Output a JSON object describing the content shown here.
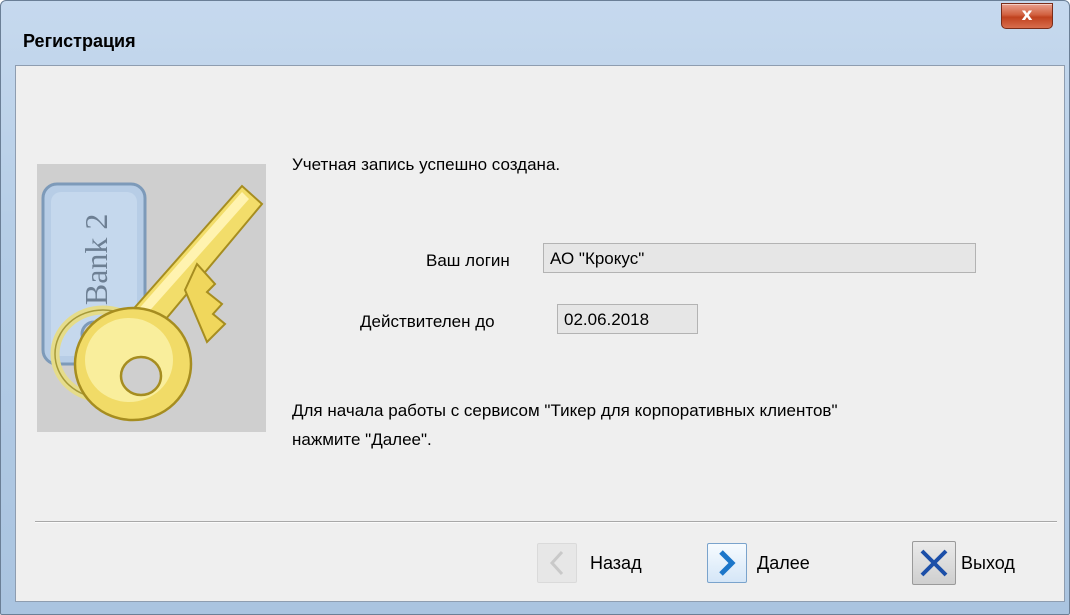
{
  "window": {
    "title": "Регистрация",
    "close_icon_name": "close-icon",
    "close_glyph": "x"
  },
  "content": {
    "created_message": "Учетная запись успешно создана.",
    "login_label": "Ваш логин",
    "login_value": "АО \"Крокус\"",
    "valid_label": "Действителен до",
    "valid_value": "02.06.2018",
    "info_line1": "Для начала работы с сервисом \"Тикер для корпоративных клиентов\"",
    "info_line2": "нажмите \"Далее\".",
    "image_tag_text": "iBank 2"
  },
  "buttons": {
    "back_label": "Назад",
    "next_label": "Далее",
    "exit_label": "Выход"
  },
  "colors": {
    "title_bar": "#b5cde6",
    "client_bg": "#efefef",
    "close_red": "#c0421f",
    "next_arrow": "#1c76c9",
    "exit_x": "#1c4fa8"
  }
}
